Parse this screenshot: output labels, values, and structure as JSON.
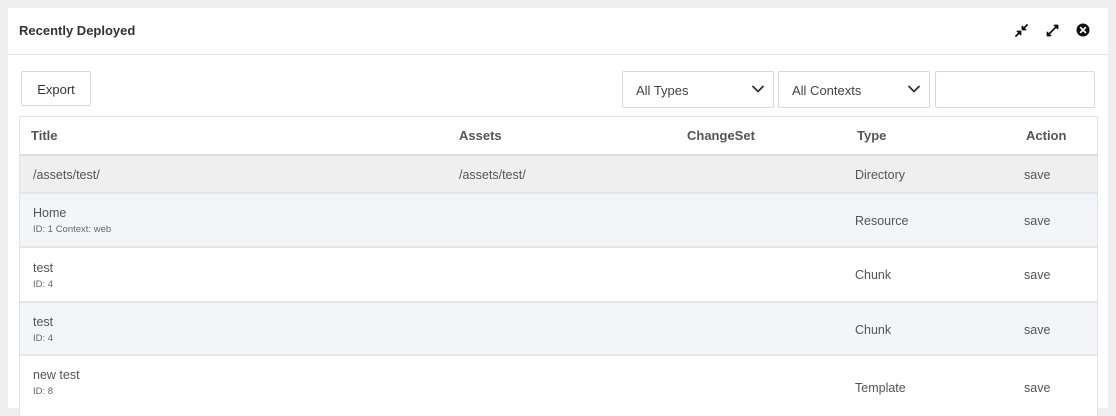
{
  "panel": {
    "title": "Recently Deployed"
  },
  "header_icons": [
    {
      "name": "collapse-icon"
    },
    {
      "name": "expand-icon"
    },
    {
      "name": "close-icon"
    }
  ],
  "toolbar": {
    "export_label": "Export",
    "type_filter": "All Types",
    "context_filter": "All Contexts",
    "search_value": ""
  },
  "grid": {
    "columns": [
      "Title",
      "Assets",
      "ChangeSet",
      "Type",
      "Action"
    ],
    "rows": [
      {
        "title": "/assets/test/",
        "sub": "",
        "assets": "/assets/test/",
        "changeset": "",
        "type": "Directory",
        "action": "save"
      },
      {
        "title": "Home",
        "sub": "ID: 1 Context: web",
        "assets": "",
        "changeset": "",
        "type": "Resource",
        "action": "save"
      },
      {
        "title": "test",
        "sub": "ID: 4",
        "assets": "",
        "changeset": "",
        "type": "Chunk",
        "action": "save"
      },
      {
        "title": "test",
        "sub": "ID: 4",
        "assets": "",
        "changeset": "",
        "type": "Chunk",
        "action": "save"
      },
      {
        "title": "new test",
        "sub": "ID: 8",
        "assets": "",
        "changeset": "",
        "type": "Template",
        "action": "save"
      }
    ]
  },
  "colors": {
    "row_selected": "#efefef",
    "row_alt": "#f4f5f8",
    "row_plain": "#ffffff"
  }
}
